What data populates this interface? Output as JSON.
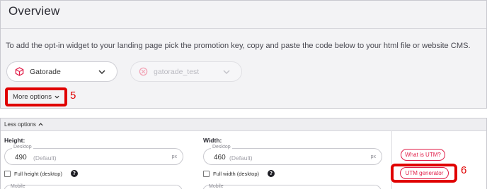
{
  "overview": {
    "title": "Overview",
    "instructions": "To add the opt-in widget to your landing page pick the promotion key, copy and paste the code below to your html file or website CMS.",
    "brand_select": {
      "value": "Gatorade",
      "icon": "brand-box-icon"
    },
    "promotion_key_select": {
      "value": "gatorade_test",
      "icon": "promotion-icon",
      "disabled": true
    },
    "more_options_label": "More options"
  },
  "annotations": {
    "step_5": "5",
    "step_6": "6"
  },
  "options_panel": {
    "less_options_label": "Less options",
    "height": {
      "label": "Height:",
      "desktop_legend": "Desktop",
      "value": "490",
      "default_hint": "(Default)",
      "unit": "px",
      "full_checkbox_label": "Full height (desktop)",
      "mobile_legend": "Mobile"
    },
    "width": {
      "label": "Width:",
      "desktop_legend": "Desktop",
      "value": "460",
      "default_hint": "(Default)",
      "unit": "px",
      "full_checkbox_label": "Full width (desktop)",
      "mobile_legend": "Mobile"
    },
    "utm": {
      "what_is_label": "What is UTM?",
      "generator_label": "UTM generator"
    }
  },
  "colors": {
    "accent_pink": "#e11d48",
    "highlight_red": "#e00000",
    "panel_bg": "#f3f3f5"
  }
}
